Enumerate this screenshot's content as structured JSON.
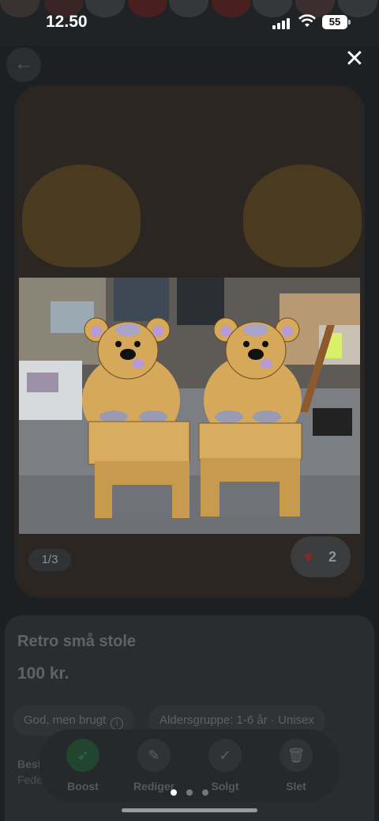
{
  "status_bar": {
    "time": "12.50",
    "battery": "55"
  },
  "gallery": {
    "counter": "1/3",
    "likes": "2"
  },
  "listing": {
    "title": "Retro små stole",
    "price": "100 kr.",
    "condition": "God, men brugt",
    "age_group": "Aldersgruppe: 1-6 år · Unisex",
    "detail_label": "Best",
    "detail_value": "Fede"
  },
  "actions": [
    {
      "label": "Boost",
      "icon": "rocket-icon"
    },
    {
      "label": "Rediger",
      "icon": "pencil-icon"
    },
    {
      "label": "Solgt",
      "icon": "check-icon"
    },
    {
      "label": "Slet",
      "icon": "trash-icon"
    }
  ],
  "pager": {
    "total": 3,
    "current": 1
  },
  "colors": {
    "background": "#1d2023",
    "boost": "#21452e",
    "heart": "#7a2e2a"
  }
}
